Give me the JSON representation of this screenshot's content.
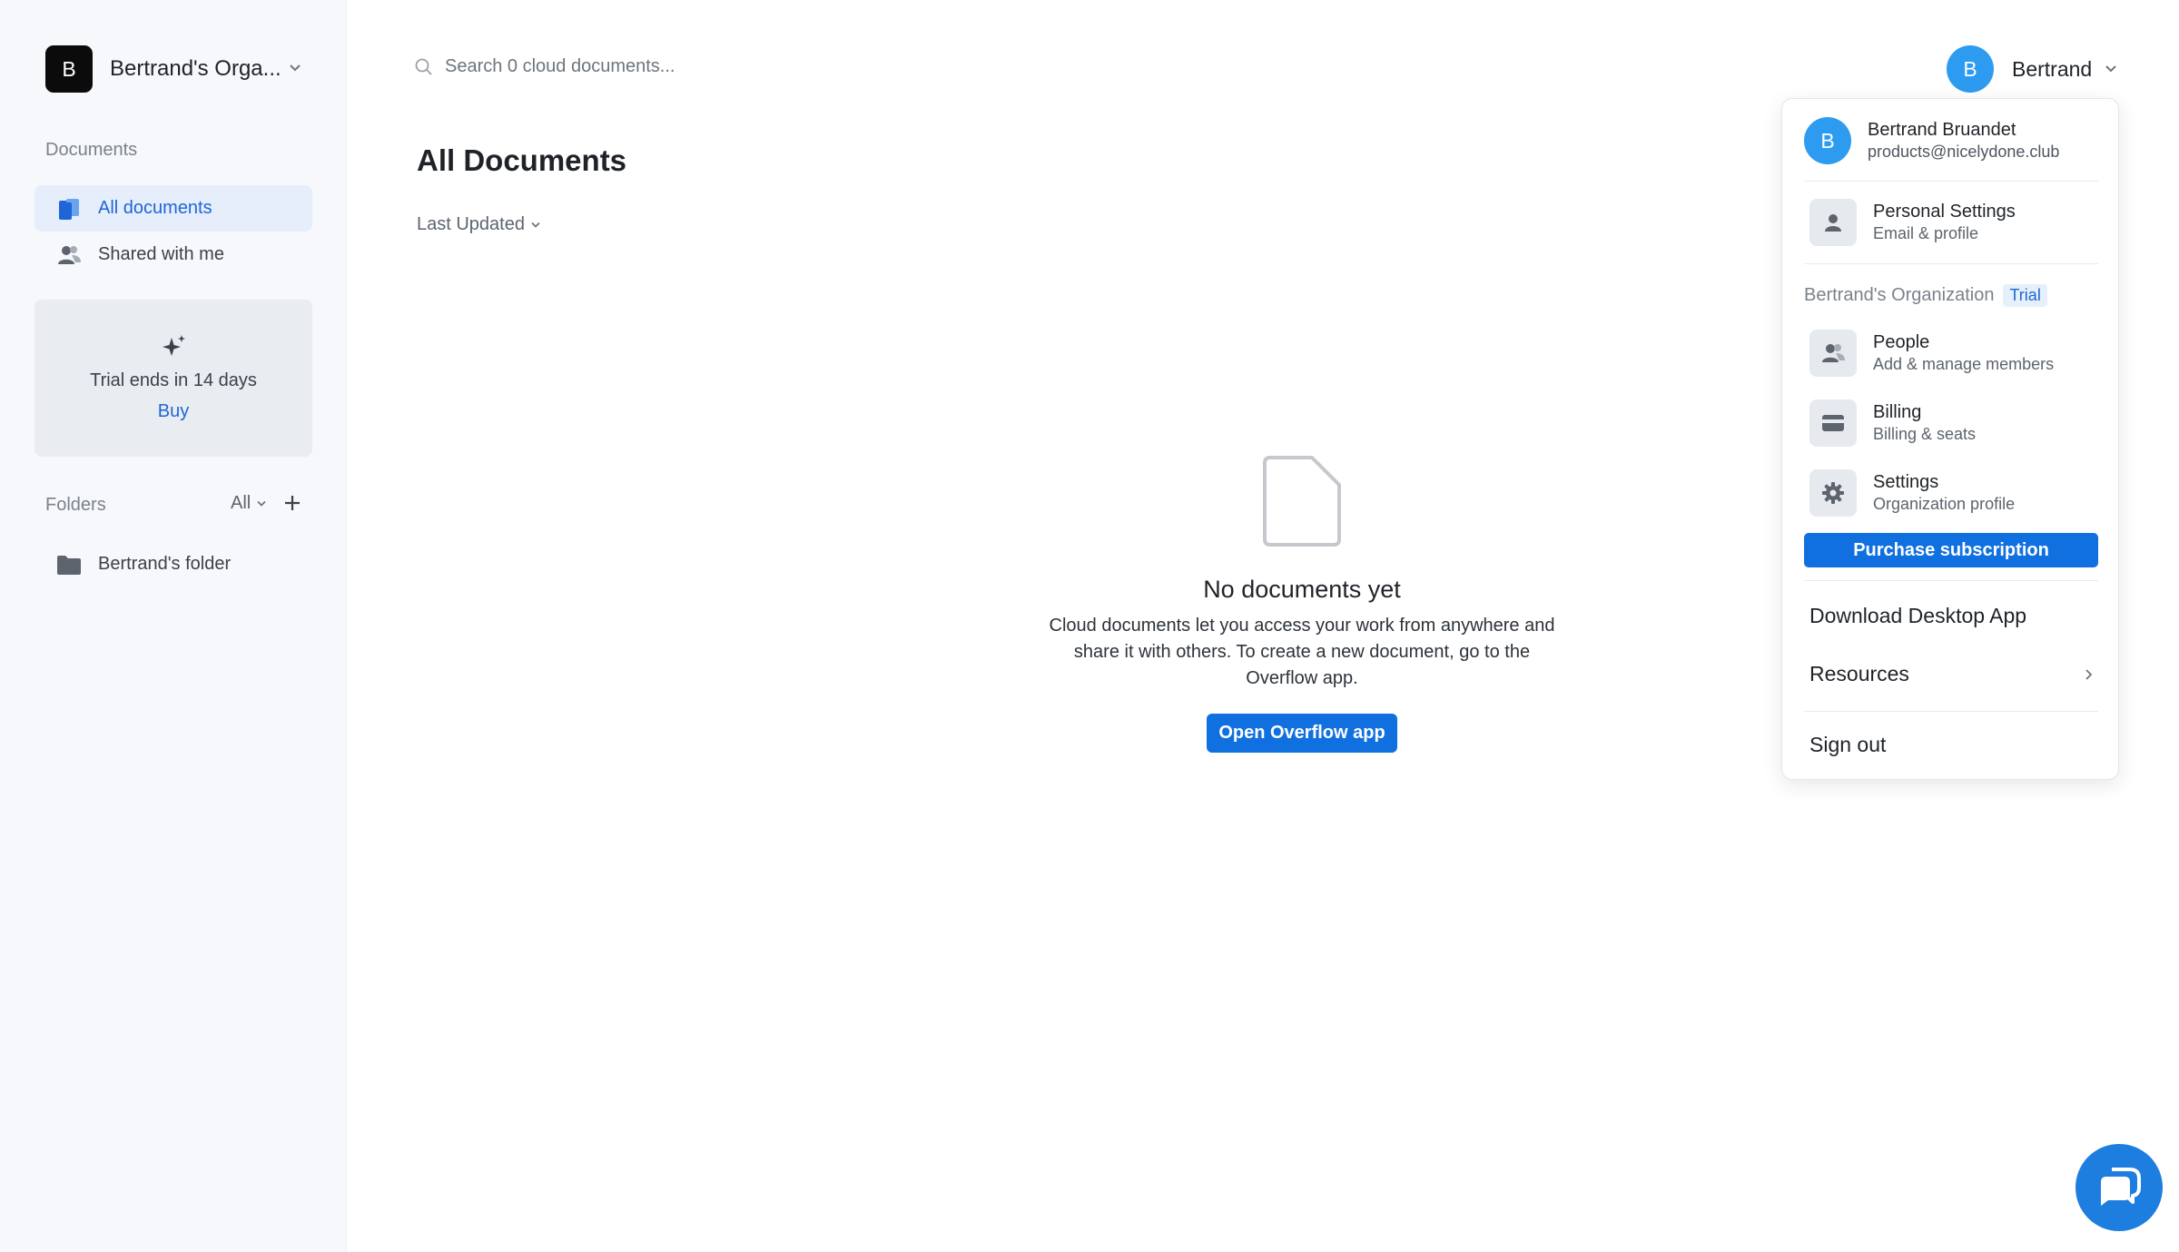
{
  "sidebar": {
    "org_initial": "B",
    "org_name": "Bertrand's Orga...",
    "documents_label": "Documents",
    "nav": [
      {
        "label": "All documents",
        "icon": "documents-icon",
        "active": true
      },
      {
        "label": "Shared with me",
        "icon": "people-icon",
        "active": false
      }
    ],
    "trial": {
      "text": "Trial ends in 14 days",
      "buy": "Buy"
    },
    "folders_label": "Folders",
    "folders_filter": "All",
    "folders": [
      {
        "label": "Bertrand's folder",
        "icon": "folder-icon"
      }
    ]
  },
  "search": {
    "placeholder": "Search 0 cloud documents..."
  },
  "main": {
    "title": "All Documents",
    "sort_label": "Last Updated",
    "empty": {
      "title": "No documents yet",
      "description": "Cloud documents let you access your work from anywhere and share it with others. To create a new document, go to the Overflow app.",
      "button": "Open Overflow app"
    }
  },
  "header": {
    "user_initial": "B",
    "user_name": "Bertrand"
  },
  "dropdown": {
    "profile": {
      "initial": "B",
      "name": "Bertrand Bruandet",
      "email": "products@nicelydone.club"
    },
    "personal": {
      "title": "Personal Settings",
      "sub": "Email & profile"
    },
    "org_name": "Bertrand's Organization",
    "org_badge": "Trial",
    "people": {
      "title": "People",
      "sub": "Add & manage members"
    },
    "billing": {
      "title": "Billing",
      "sub": "Billing & seats"
    },
    "settings": {
      "title": "Settings",
      "sub": "Organization profile"
    },
    "purchase": "Purchase subscription",
    "download": "Download Desktop App",
    "resources": "Resources",
    "sign_out": "Sign out"
  },
  "colors": {
    "accent": "#1170E0",
    "avatar": "#2D9BF0",
    "sidebar_bg": "#F6F8FB"
  }
}
